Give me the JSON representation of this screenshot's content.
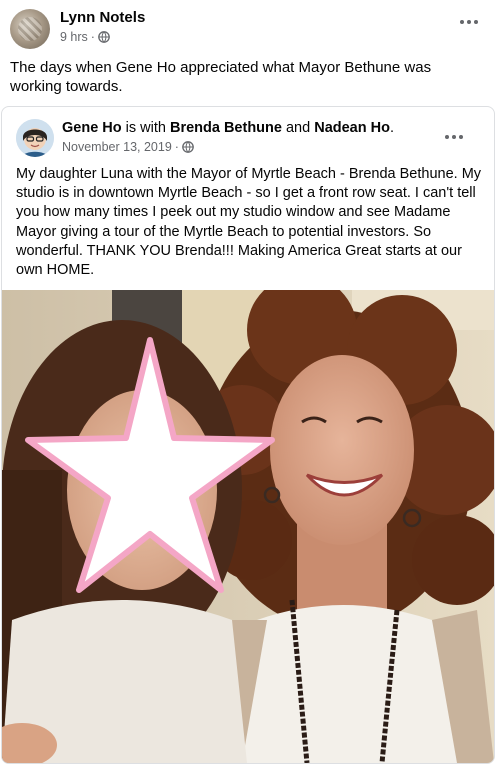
{
  "post": {
    "author": "Lynn Notels",
    "time": "9 hrs",
    "separator": "·",
    "text": "The days when Gene Ho appreciated what Mayor Bethune was working towards."
  },
  "shared_post": {
    "author": "Gene Ho",
    "connector_1": " is with ",
    "tagged_1": "Brenda Bethune",
    "connector_2": " and ",
    "tagged_2": "Nadean Ho",
    "end_punct": ".",
    "date": "November 13, 2019",
    "separator": "·",
    "text": "My daughter Luna with the Mayor of Myrtle Beach - Brenda Bethune. My studio is in downtown Myrtle Beach - so I get a front row seat. I can't tell you how many times I peek out my studio window and see Madame Mayor giving a tour of the Myrtle Beach to potential investors. So wonderful. THANK YOU Brenda!!! Making America Great starts at our own HOME."
  },
  "icons": {
    "privacy": "globe-icon",
    "more": "more-options-icon"
  },
  "colors": {
    "text_primary": "#050505",
    "text_secondary": "#65676b",
    "star_fill": "#ffffff",
    "star_outline": "#f4a6c6"
  }
}
